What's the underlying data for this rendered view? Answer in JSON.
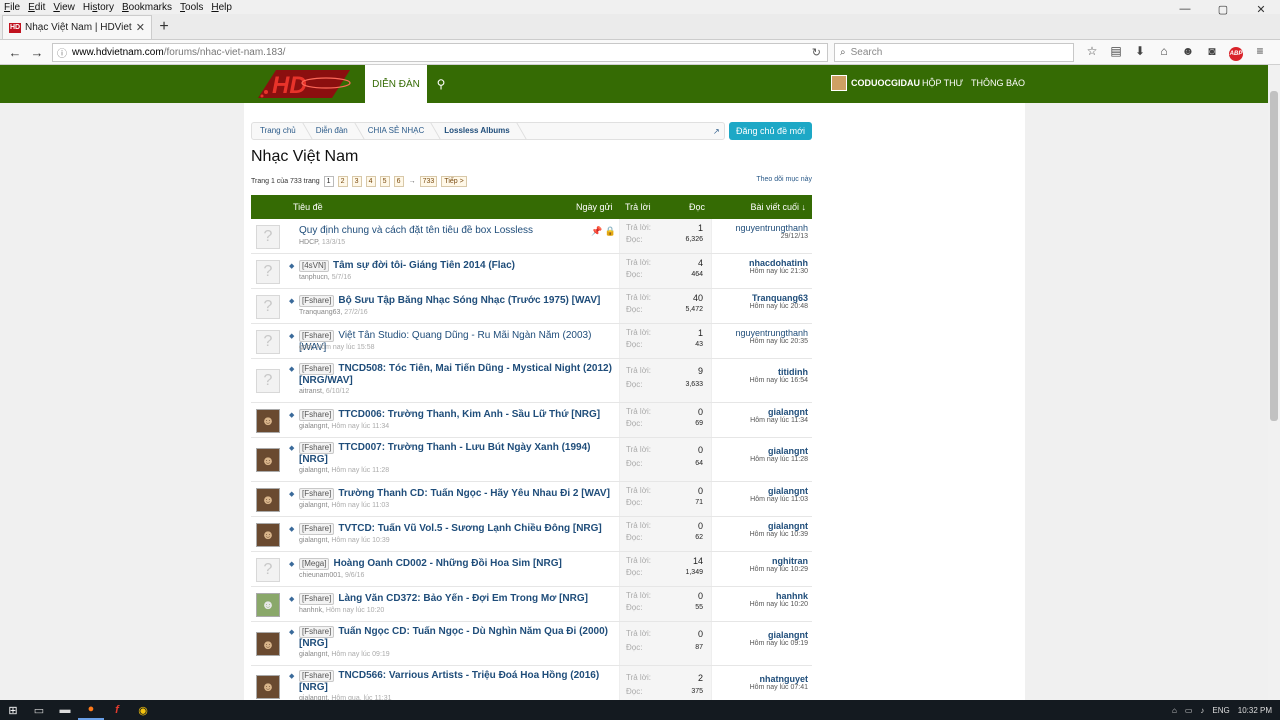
{
  "menubar": [
    "File",
    "Edit",
    "View",
    "History",
    "Bookmarks",
    "Tools",
    "Help"
  ],
  "menubar_underline": [
    "F",
    "E",
    "V",
    "s",
    "B",
    "T",
    "H"
  ],
  "window_controls": [
    "—",
    "▢",
    "✕"
  ],
  "tab": {
    "title": "Nhạc Việt Nam | HDVietna...",
    "close": "✕",
    "favicon": "HD"
  },
  "newtab": "+",
  "url": {
    "host": "www.hdvietnam.com",
    "path": "/forums/nhac-viet-nam.183/"
  },
  "search_placeholder": "Search",
  "site": {
    "nav_forum": "DIỄN ĐÀN",
    "username": "CODUOCGIDAU",
    "nav_inbox": "HỘP THƯ",
    "nav_alerts": "THÔNG BÁO"
  },
  "breadcrumb": [
    "Trang chủ",
    "Diễn đàn",
    "CHIA SẺ NHẠC",
    "Lossless Albums"
  ],
  "new_thread_button": "Đăng chủ đề mới",
  "page_title": "Nhạc Việt Nam",
  "pager": {
    "label": "Trang 1 của 733 trang",
    "pages": [
      "1",
      "2",
      "3",
      "4",
      "5",
      "6"
    ],
    "arrow": "→",
    "last": "733",
    "next": "Tiếp >"
  },
  "follow_link": "Theo dõi mục này",
  "table_header": {
    "title": "Tiêu đề",
    "date": "Ngày gửi",
    "replies": "Trả lời",
    "views": "Đọc",
    "last": "Bài viết cuối ↓"
  },
  "labels": {
    "replies": "Trả lời:",
    "views": "Đọc:"
  },
  "threads": [
    {
      "tag": "",
      "title": "Quy định chung và cách đặt tên tiêu đề box Lossless",
      "author": "HDCP,",
      "date": "13/3/15",
      "replies": "1",
      "views": "6,326",
      "last_user": "nguyentrungthanh",
      "last_date": "29/12/13",
      "sticky": true,
      "avatar": "none",
      "bold": false
    },
    {
      "tag": "[4sVN]",
      "title": "Tâm sự đời tôi- Giáng Tiên 2014 (Flac)",
      "author": "tanphucn,",
      "date": "5/7/16",
      "replies": "4",
      "views": "464",
      "last_user": "nhacdohatinh",
      "last_date": "Hôm nay lúc 21:30",
      "sticky": false,
      "avatar": "none",
      "bold": true
    },
    {
      "tag": "[Fshare]",
      "title": "Bộ Sưu Tập Băng Nhạc Sóng Nhạc (Trước 1975) [WAV]",
      "author": "Tranquang63,",
      "date": "27/2/16",
      "replies": "40",
      "views": "5,472",
      "last_user": "Tranquang63",
      "last_date": "Hôm nay lúc 20:48",
      "sticky": false,
      "avatar": "none",
      "bold": true
    },
    {
      "tag": "[Fshare]",
      "title": "Việt Tân Studio: Quang Dũng - Ru Mãi Ngàn Năm (2003) [WAV]",
      "author": "gobi,",
      "date": "Hôm nay lúc 15:58",
      "replies": "1",
      "views": "43",
      "last_user": "nguyentrungthanh",
      "last_date": "Hôm nay lúc 20:35",
      "sticky": false,
      "avatar": "none",
      "bold": false
    },
    {
      "tag": "[Fshare]",
      "title": "TNCD508: Tóc Tiên, Mai Tiến Dũng - Mystical Night (2012) [NRG/WAV]",
      "author": "aitranst,",
      "date": "6/10/12",
      "replies": "9",
      "views": "3,633",
      "last_user": "titidinh",
      "last_date": "Hôm nay lúc 16:54",
      "sticky": false,
      "avatar": "none",
      "bold": true
    },
    {
      "tag": "[Fshare]",
      "title": "TTCD006: Trường Thanh, Kim Anh - Sầu Lữ Thứ [NRG]",
      "author": "gialangnt,",
      "date": "Hôm nay lúc 11:34",
      "replies": "0",
      "views": "69",
      "last_user": "gialangnt",
      "last_date": "Hôm nay lúc 11:34",
      "sticky": false,
      "avatar": "photo",
      "bold": true
    },
    {
      "tag": "[Fshare]",
      "title": "TTCD007: Trường Thanh - Lưu Bút Ngày Xanh (1994) [NRG]",
      "author": "gialangnt,",
      "date": "Hôm nay lúc 11:28",
      "replies": "0",
      "views": "64",
      "last_user": "gialangnt",
      "last_date": "Hôm nay lúc 11:28",
      "sticky": false,
      "avatar": "photo",
      "bold": true
    },
    {
      "tag": "[Fshare]",
      "title": "Trường Thanh CD: Tuấn Ngọc - Hãy Yêu Nhau Đi 2 [WAV]",
      "author": "gialangnt,",
      "date": "Hôm nay lúc 11:03",
      "replies": "0",
      "views": "71",
      "last_user": "gialangnt",
      "last_date": "Hôm nay lúc 11:03",
      "sticky": false,
      "avatar": "photo",
      "bold": true
    },
    {
      "tag": "[Fshare]",
      "title": "TVTCD: Tuấn Vũ Vol.5 - Sương Lạnh Chiều Đông [NRG]",
      "author": "gialangnt,",
      "date": "Hôm nay lúc 10:39",
      "replies": "0",
      "views": "62",
      "last_user": "gialangnt",
      "last_date": "Hôm nay lúc 10:39",
      "sticky": false,
      "avatar": "photo",
      "bold": true
    },
    {
      "tag": "[Mega]",
      "title": "Hoàng Oanh CD002 - Những Đồi Hoa Sim [NRG]",
      "author": "chieunam001,",
      "date": "9/6/16",
      "replies": "14",
      "views": "1,349",
      "last_user": "nghitran",
      "last_date": "Hôm nay lúc 10:29",
      "sticky": false,
      "avatar": "none",
      "bold": true
    },
    {
      "tag": "[Fshare]",
      "title": "Làng Văn CD372: Bảo Yến - Đợi Em Trong Mơ [NRG]",
      "author": "hanhnk,",
      "date": "Hôm nay lúc 10:20",
      "replies": "0",
      "views": "55",
      "last_user": "hanhnk",
      "last_date": "Hôm nay lúc 10:20",
      "sticky": false,
      "avatar": "photo2",
      "bold": true
    },
    {
      "tag": "[Fshare]",
      "title": "Tuấn Ngọc CD: Tuấn Ngọc - Dù Nghìn Năm Qua Đi (2000) [NRG]",
      "author": "gialangnt,",
      "date": "Hôm nay lúc 09:19",
      "replies": "0",
      "views": "87",
      "last_user": "gialangnt",
      "last_date": "Hôm nay lúc 09:19",
      "sticky": false,
      "avatar": "photo",
      "bold": true
    },
    {
      "tag": "[Fshare]",
      "title": "TNCD566: Varrious Artists - Triệu Đoá Hoa Hồng (2016) [NRG]",
      "author": "gialangnt,",
      "date": "Hôm qua, lúc 11:31",
      "replies": "2",
      "views": "375",
      "last_user": "nhatnguyet",
      "last_date": "Hôm nay lúc 07:41",
      "sticky": false,
      "avatar": "photo",
      "bold": true
    }
  ],
  "taskbar": {
    "lang": "ENG",
    "time": "10:32 PM"
  },
  "colors": {
    "brand_green": "#356b04",
    "link_blue": "#1f4d7a",
    "button_teal": "#1da8c6"
  }
}
